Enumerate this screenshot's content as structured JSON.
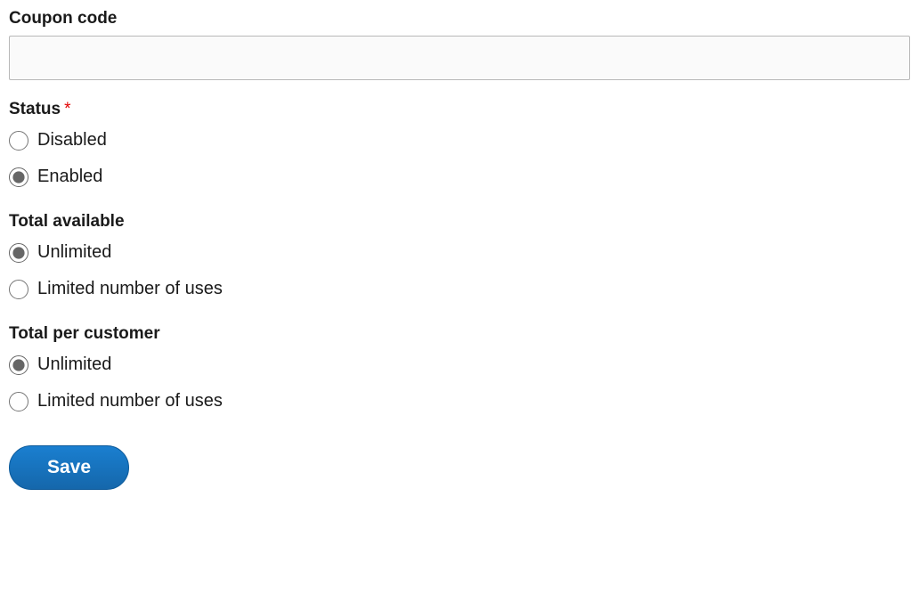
{
  "coupon_code": {
    "label": "Coupon code",
    "value": ""
  },
  "status": {
    "label": "Status",
    "required": true,
    "options": [
      {
        "label": "Disabled",
        "checked": false
      },
      {
        "label": "Enabled",
        "checked": true
      }
    ]
  },
  "total_available": {
    "label": "Total available",
    "options": [
      {
        "label": "Unlimited",
        "checked": true
      },
      {
        "label": "Limited number of uses",
        "checked": false
      }
    ]
  },
  "total_per_customer": {
    "label": "Total per customer",
    "options": [
      {
        "label": "Unlimited",
        "checked": true
      },
      {
        "label": "Limited number of uses",
        "checked": false
      }
    ]
  },
  "actions": {
    "save_label": "Save"
  }
}
